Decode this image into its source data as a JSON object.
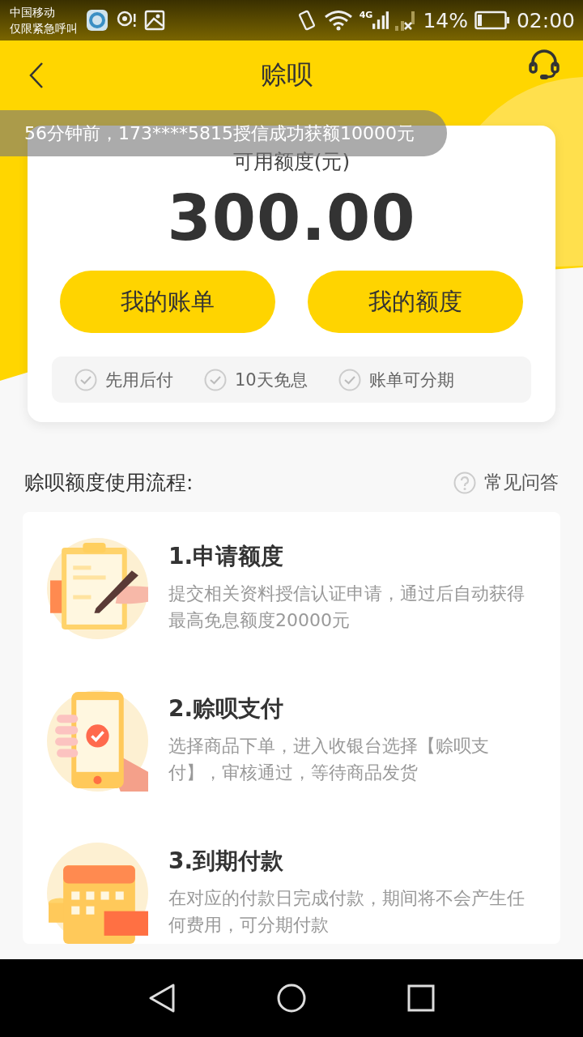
{
  "status_bar": {
    "carrier": "中国移动",
    "carrier_note": "仅限紧急呼叫",
    "network": "4G",
    "battery_percent": "14%",
    "time": "02:00"
  },
  "header": {
    "title": "赊呗"
  },
  "toast": {
    "text": "56分钟前，173****5815授信成功获额10000元"
  },
  "credit_card": {
    "label": "可用额度(元)",
    "amount": "300.00",
    "buttons": [
      "我的账单",
      "我的额度"
    ],
    "features": [
      "先用后付",
      "10天免息",
      "账单可分期"
    ]
  },
  "process": {
    "title": "赊呗额度使用流程:",
    "help_link": "常见问答",
    "steps": [
      {
        "kind": "apply",
        "title": "1.申请额度",
        "description": "提交相关资料授信认证申请，通过后自动获得最高免息额度20000元"
      },
      {
        "kind": "pay",
        "title": "2.赊呗支付",
        "description": "选择商品下单，进入收银台选择【赊呗支付】，审核通过，等待商品发货"
      },
      {
        "kind": "repay",
        "title": "3.到期付款",
        "description": "在对应的付款日完成付款，期间将不会产生任何费用，可分期付款"
      }
    ]
  }
}
